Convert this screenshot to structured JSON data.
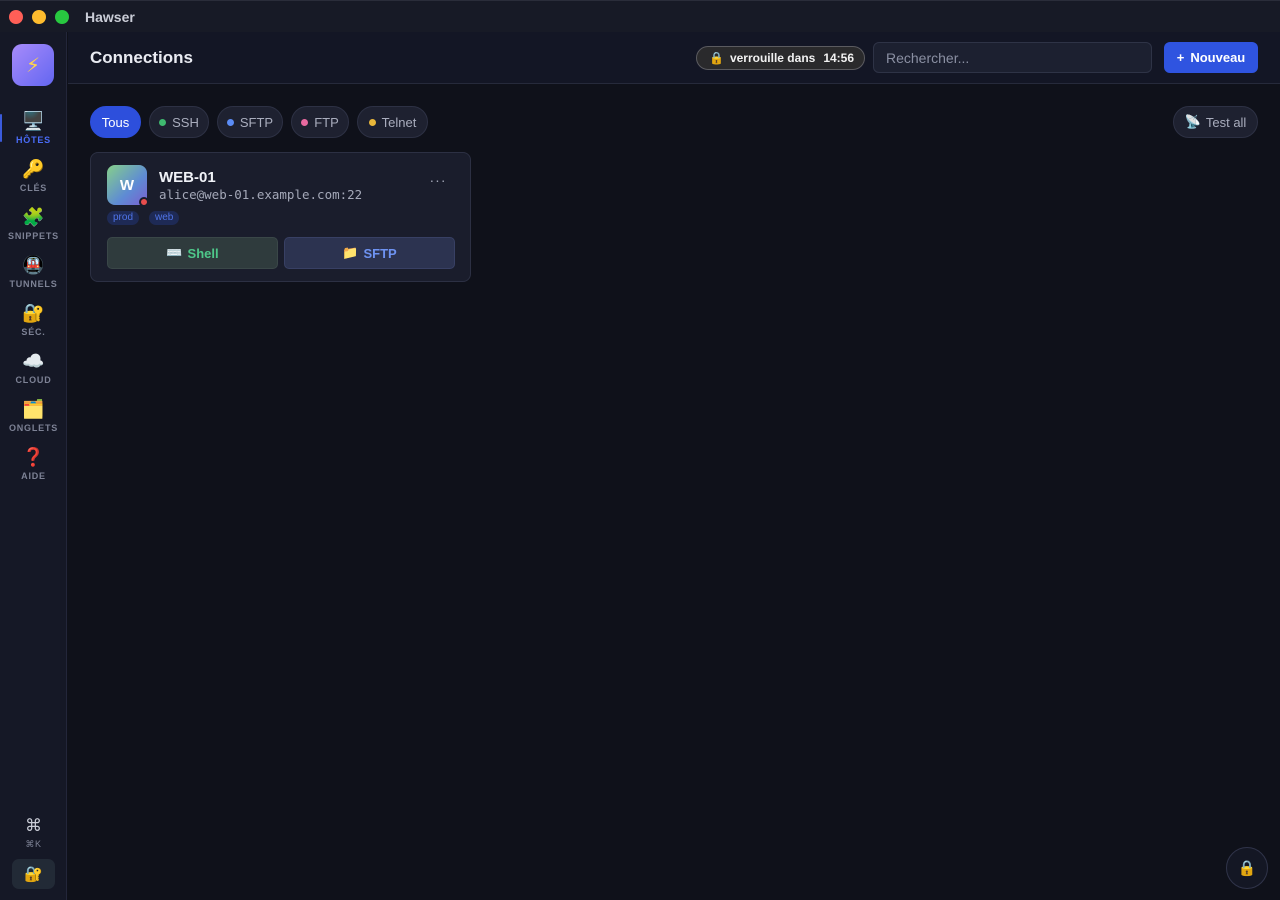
{
  "window": {
    "title": "Hawser"
  },
  "sidebar": {
    "logo_icon": "⚡",
    "items": [
      {
        "icon": "🖥️",
        "label": "HÔTES",
        "active": true
      },
      {
        "icon": "🔑",
        "label": "CLÉS",
        "active": false
      },
      {
        "icon": "🧩",
        "label": "SNIPPETS",
        "active": false
      },
      {
        "icon": "🚇",
        "label": "TUNNELS",
        "active": false
      },
      {
        "icon": "🔐",
        "label": "SÉC.",
        "active": false
      },
      {
        "icon": "☁️",
        "label": "CLOUD",
        "active": false
      },
      {
        "icon": "🗂️",
        "label": "ONGLETS",
        "active": false
      },
      {
        "icon": "❓",
        "label": "AIDE",
        "active": false
      }
    ],
    "command": {
      "icon": "⌘",
      "label": "⌘K"
    },
    "lock_icon": "🔐"
  },
  "header": {
    "title": "Connections",
    "lock_pill": {
      "icon": "🔒",
      "text": "verrouille dans",
      "time": "14:56"
    },
    "search_placeholder": "Rechercher...",
    "new_button": {
      "icon": "+",
      "label": "Nouveau"
    }
  },
  "filters": [
    {
      "label": "Tous",
      "active": true,
      "dot": null
    },
    {
      "label": "SSH",
      "active": false,
      "dot": "#3fb96f"
    },
    {
      "label": "SFTP",
      "active": false,
      "dot": "#5b8cf5"
    },
    {
      "label": "FTP",
      "active": false,
      "dot": "#e86aa0"
    },
    {
      "label": "Telnet",
      "active": false,
      "dot": "#e9b73a"
    }
  ],
  "test_all": {
    "icon": "📡",
    "label": "Test all"
  },
  "hosts": [
    {
      "initial": "W",
      "name": "WEB-01",
      "address": "alice@web-01.example.com:22",
      "status_color": "#e84d4d",
      "tags": [
        "prod",
        "web"
      ],
      "more_icon": "···",
      "actions": {
        "shell": {
          "icon": "⌨️",
          "label": "Shell"
        },
        "sftp": {
          "icon": "📁",
          "label": "SFTP"
        }
      }
    }
  ],
  "fab_lock_icon": "🔒"
}
